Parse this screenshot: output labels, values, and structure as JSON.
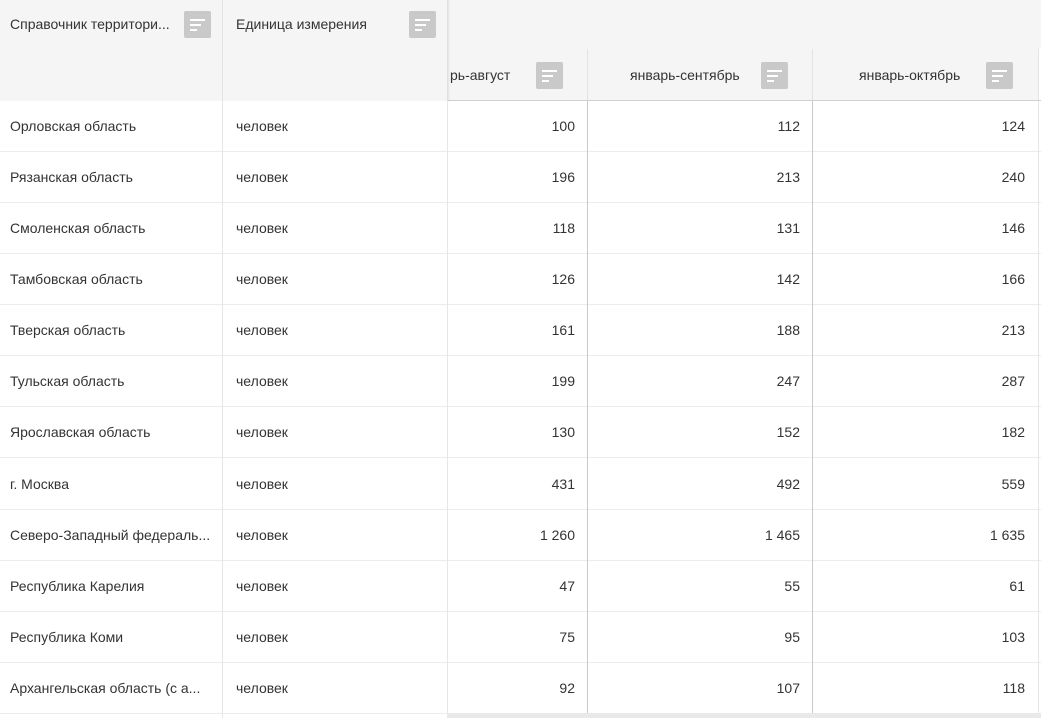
{
  "table": {
    "columns": {
      "region": "Справочник территори...",
      "unit": "Единица измерения",
      "period1": "рь-август",
      "period2": "январь-сентябрь",
      "period3": "январь-октябрь"
    },
    "rows": [
      {
        "region": "Орловская область",
        "unit": "человек",
        "v1": "100",
        "v2": "112",
        "v3": "124"
      },
      {
        "region": "Рязанская область",
        "unit": "человек",
        "v1": "196",
        "v2": "213",
        "v3": "240"
      },
      {
        "region": "Смоленская область",
        "unit": "человек",
        "v1": "118",
        "v2": "131",
        "v3": "146"
      },
      {
        "region": "Тамбовская область",
        "unit": "человек",
        "v1": "126",
        "v2": "142",
        "v3": "166"
      },
      {
        "region": "Тверская область",
        "unit": "человек",
        "v1": "161",
        "v2": "188",
        "v3": "213"
      },
      {
        "region": "Тульская область",
        "unit": "человек",
        "v1": "199",
        "v2": "247",
        "v3": "287"
      },
      {
        "region": "Ярославская область",
        "unit": "человек",
        "v1": "130",
        "v2": "152",
        "v3": "182"
      },
      {
        "region": "г. Москва",
        "unit": "человек",
        "v1": "431",
        "v2": "492",
        "v3": "559"
      },
      {
        "region": "Северо-Западный федераль...",
        "unit": "человек",
        "v1": "1 260",
        "v2": "1 465",
        "v3": "1 635"
      },
      {
        "region": "Республика Карелия",
        "unit": "человек",
        "v1": "47",
        "v2": "55",
        "v3": "61"
      },
      {
        "region": "Республика Коми",
        "unit": "человек",
        "v1": "75",
        "v2": "95",
        "v3": "103"
      },
      {
        "region": "Архангельская область (с а...",
        "unit": "человек",
        "v1": "92",
        "v2": "107",
        "v3": "118"
      }
    ]
  },
  "icons": {
    "sort": "sort-icon"
  },
  "colors": {
    "header_bg": "#f5f5f5",
    "icon_bg": "#c9c9c9",
    "text": "#333333",
    "divider": "#ececec"
  }
}
